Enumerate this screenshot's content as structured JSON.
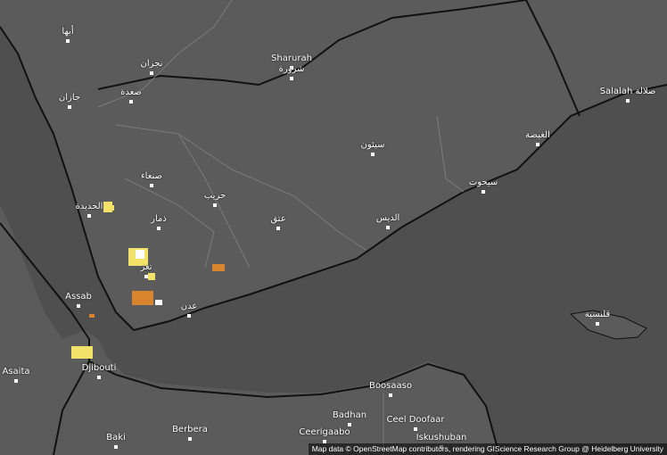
{
  "map": {
    "colors": {
      "land": "#5b5b5b",
      "sea": "#4f4f4f",
      "border": "#111111",
      "admin_border": "#7a7a7a",
      "radar_yellow": "#f3e26a",
      "radar_orange": "#d8842f",
      "radar_white": "#ffffff"
    },
    "places": [
      {
        "id": "abha",
        "label": "أبها"
      },
      {
        "id": "najran",
        "label": "نجران"
      },
      {
        "id": "sharurah",
        "label": "Sharurah"
      },
      {
        "id": "sharurah-ar",
        "label": "شرورة"
      },
      {
        "id": "jizan",
        "label": "جازان"
      },
      {
        "id": "saada",
        "label": "صعدة"
      },
      {
        "id": "salalah",
        "label": "Salalah صلالة"
      },
      {
        "id": "ghaydah",
        "label": "الغيضة"
      },
      {
        "id": "sayun",
        "label": "سيئون"
      },
      {
        "id": "sanaa",
        "label": "صنعاء"
      },
      {
        "id": "hudaydah",
        "label": "الحديدة"
      },
      {
        "id": "harib",
        "label": "حريب"
      },
      {
        "id": "dhamar",
        "label": "ذمار"
      },
      {
        "id": "ataq",
        "label": "عتق"
      },
      {
        "id": "seiyun2",
        "label": "سيئون"
      },
      {
        "id": "mukalla",
        "label": "سيحوت"
      },
      {
        "id": "ghaydah2",
        "label": "الديس"
      },
      {
        "id": "taizz",
        "label": "تعز"
      },
      {
        "id": "aden",
        "label": "عدن"
      },
      {
        "id": "assab",
        "label": "Assab"
      },
      {
        "id": "djibouti",
        "label": "Djibouti"
      },
      {
        "id": "asaita",
        "label": "Asaita"
      },
      {
        "id": "socotra",
        "label": "قلنسية"
      },
      {
        "id": "bosaso",
        "label": "Boosaaso"
      },
      {
        "id": "badhan",
        "label": "Badhan"
      },
      {
        "id": "ceel",
        "label": "Ceel Doofaar"
      },
      {
        "id": "berbera",
        "label": "Berbera"
      },
      {
        "id": "ceerigaabo",
        "label": "Ceerigaabo"
      },
      {
        "id": "iskushuban",
        "label": "Iskushuban"
      },
      {
        "id": "baki",
        "label": "Baki"
      }
    ],
    "attribution": "Map data © OpenStreetMap contributors, rendering GIScience Research Group @ Heidelberg University"
  }
}
